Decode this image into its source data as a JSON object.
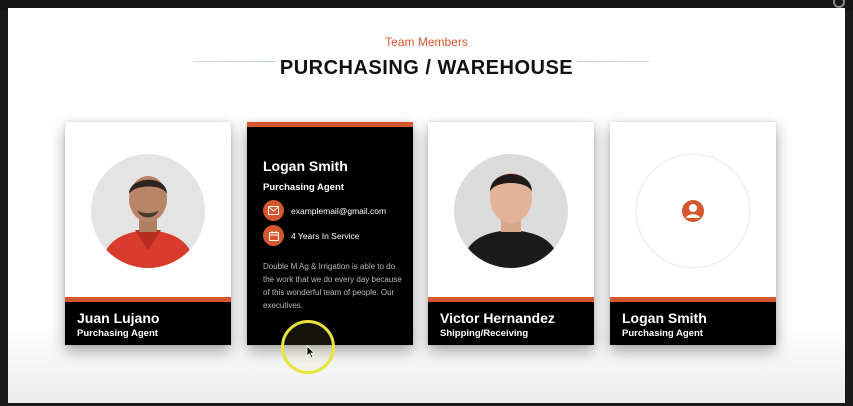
{
  "section": {
    "eyebrow": "Team Members",
    "title": "PURCHASING / WAREHOUSE"
  },
  "colors": {
    "accent": "#d4572f",
    "card_dark": "#000000",
    "highlight": "#e7e43a"
  },
  "members": [
    {
      "name": "Juan Lujano",
      "role": "Purchasing Agent"
    },
    {
      "name": "Logan Smith",
      "role": "Purchasing Agent",
      "email": "examplemail@gmail.com",
      "service": "4 Years In Service",
      "description": "Double M Ag & Irrigation is able to do the work that we do every day because of this wonderful team of people. Our executives."
    },
    {
      "name": "Victor Hernandez",
      "role": "Shipping/Receiving"
    },
    {
      "name": "Logan Smith",
      "role": "Purchasing Agent"
    }
  ],
  "icons": {
    "email": "envelope-icon",
    "service": "calendar-icon",
    "placeholder": "user-icon"
  }
}
